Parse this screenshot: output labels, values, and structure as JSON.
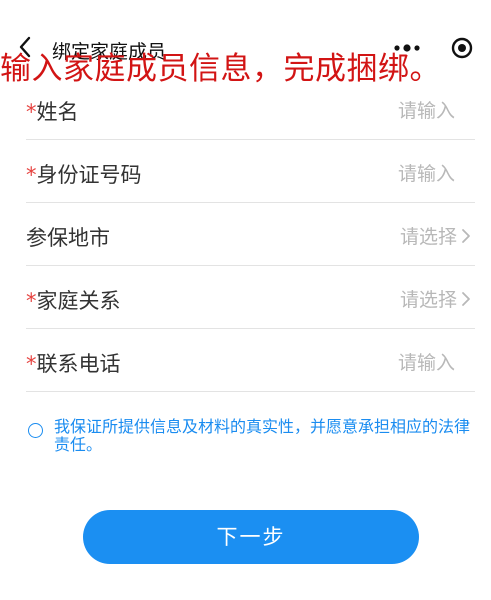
{
  "nav": {
    "title": "绑定家庭成员",
    "back_icon": "chevron-left-icon",
    "more_icon": "more-dots-icon",
    "close_icon": "target-circle-icon"
  },
  "overlay_caption": "输入家庭成员信息，完成捆绑。",
  "form": {
    "required_mark": "*",
    "rows": [
      {
        "label": "姓名",
        "required": true,
        "hint": "请输入",
        "type": "input"
      },
      {
        "label": "身份证号码",
        "required": true,
        "hint": "请输入",
        "type": "input"
      },
      {
        "label": "参保地市",
        "required": false,
        "hint": "请选择",
        "type": "select"
      },
      {
        "label": "家庭关系",
        "required": true,
        "hint": "请选择",
        "type": "select"
      },
      {
        "label": "联系电话",
        "required": true,
        "hint": "请输入",
        "type": "input"
      }
    ]
  },
  "agreement": {
    "text": "我保证所提供信息及材料的真实性，并愿意承担相应的法律责任。",
    "checked": false
  },
  "next_button": {
    "label": "下一步"
  },
  "colors": {
    "accent": "#1b8ff2",
    "required": "#e64340",
    "caption": "#d21414",
    "hint": "#b8b8b8"
  }
}
